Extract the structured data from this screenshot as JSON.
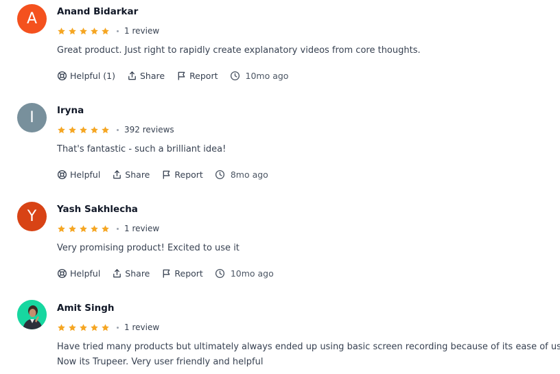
{
  "colors": {
    "star": "#f5a623",
    "avatar_anand": "#f4511e",
    "avatar_iryna": "#78909c",
    "avatar_yash": "#d84315",
    "avatar_amit_bg": "#17d7a0"
  },
  "icons": {
    "helpful": "lifebuoy-icon",
    "share": "share-icon",
    "report": "flag-icon",
    "time": "clock-icon",
    "rating": "star-icon"
  },
  "reviews": [
    {
      "avatar_letter": "A",
      "name": "Anand Bidarkar",
      "stars": 5,
      "review_count": "1 review",
      "text": "Great product. Just right to rapidly create explanatory videos from core thoughts.",
      "helpful_label": "Helpful (1)",
      "share_label": "Share",
      "report_label": "Report",
      "time": "10mo ago"
    },
    {
      "avatar_letter": "I",
      "name": "Iryna",
      "stars": 5,
      "review_count": "392 reviews",
      "text": "That's fantastic - such a brilliant idea!",
      "helpful_label": "Helpful",
      "share_label": "Share",
      "report_label": "Report",
      "time": "8mo ago"
    },
    {
      "avatar_letter": "Y",
      "name": "Yash Sakhlecha",
      "stars": 5,
      "review_count": "1 review",
      "text": "Very promising product! Excited to use it",
      "helpful_label": "Helpful",
      "share_label": "Share",
      "report_label": "Report",
      "time": "10mo ago"
    },
    {
      "name": "Amit Singh",
      "stars": 5,
      "review_count": "1 review",
      "text_line1": "Have tried many products but ultimately always ended up using basic screen recording because of its ease of use.",
      "text_line2": "Now its Trupeer. Very user friendly and helpful"
    }
  ]
}
